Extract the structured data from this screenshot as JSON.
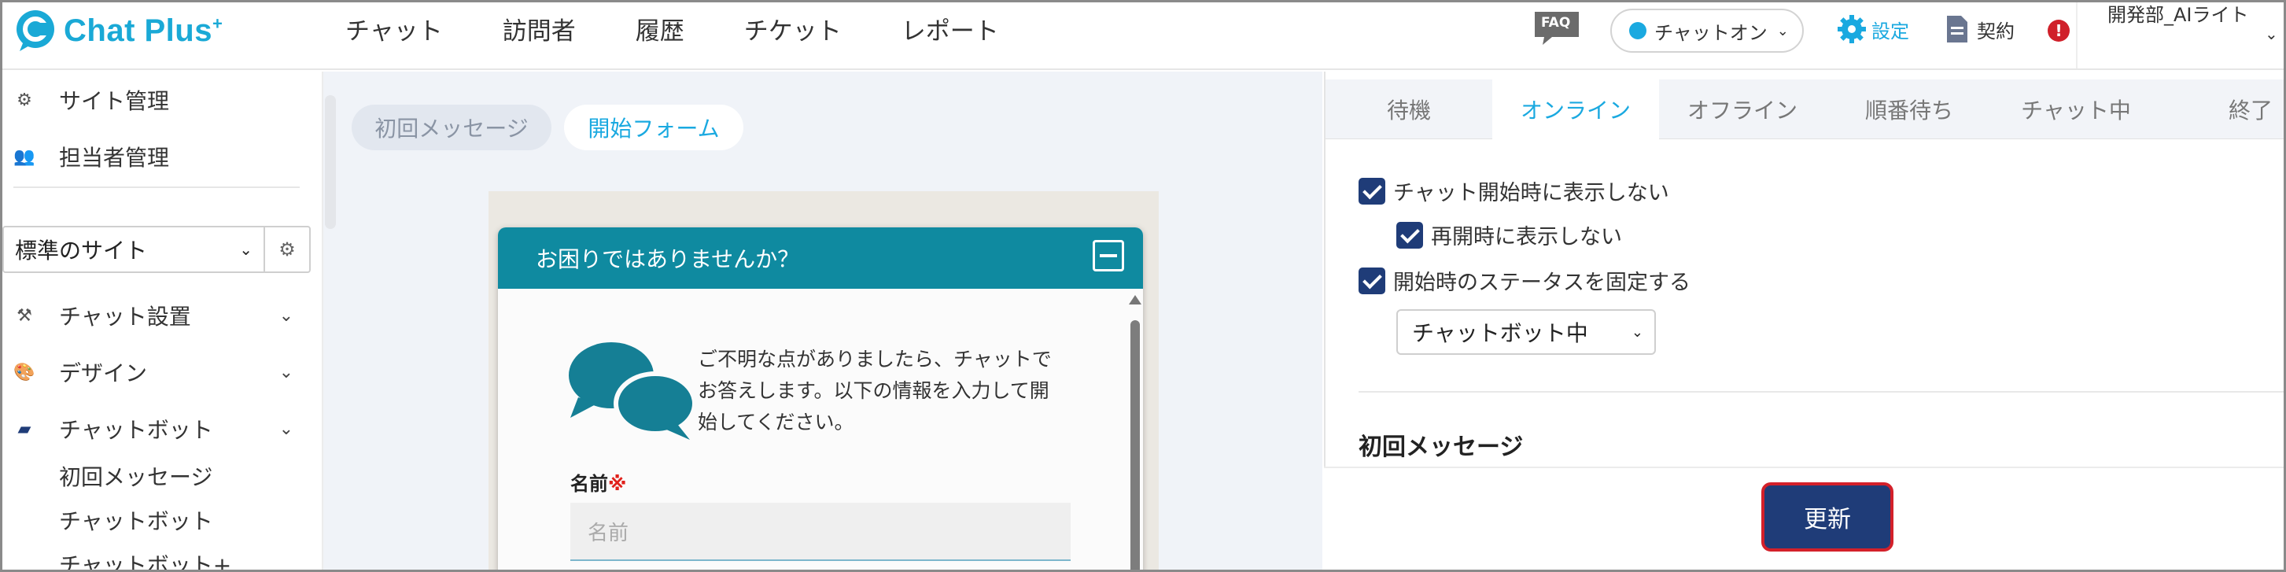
{
  "header": {
    "logo_text": "Chat Plus",
    "logo_sup": "+",
    "nav": [
      "チャット",
      "訪問者",
      "履歴",
      "チケット",
      "レポート"
    ],
    "faq_label": "FAQ",
    "status_label": "チャットオン",
    "settings_label": "設定",
    "contract_label": "契約",
    "alert_mark": "!",
    "user_name": "開発部_AIライト"
  },
  "sidebar": {
    "site_admin": "サイト管理",
    "staff_admin": "担当者管理",
    "site_select": "標準のサイト",
    "chat_setup": "チャット設置",
    "design": "デザイン",
    "chatbot": "チャットボット",
    "sub_items": [
      "初回メッセージ",
      "チャットボット",
      "チャットボット+"
    ]
  },
  "middle": {
    "tab_first_message": "初回メッセージ",
    "tab_start_form": "開始フォーム",
    "chat_title": "お困りではありませんか？",
    "chat_message": "ご不明な点がありましたら、チャットでお答えします。以下の情報を入力して開始してください。",
    "name_label": "名前",
    "required_mark": "※",
    "name_placeholder": "名前"
  },
  "right": {
    "tabs": [
      "待機",
      "オンライン",
      "オフライン",
      "順番待ち",
      "チャット中",
      "終了"
    ],
    "active_tab": "オンライン",
    "chk_hide_on_start": "チャット開始時に表示しない",
    "chk_hide_on_resume": "再開時に表示しない",
    "chk_fix_status": "開始時のステータスを固定する",
    "status_select": "チャットボット中",
    "section_title": "初回メッセージ",
    "update_button": "更新"
  },
  "colors": {
    "accent": "#1aa9e0",
    "navy": "#1f3c78",
    "chat_header": "#0f8aa0",
    "alert": "#d0202a"
  }
}
